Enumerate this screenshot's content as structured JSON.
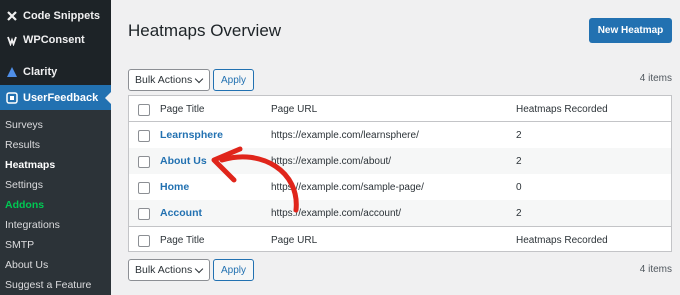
{
  "sidebar": {
    "top_items": [
      {
        "label": "Code Snippets",
        "icon": "code-snippets-icon"
      },
      {
        "label": "WPConsent",
        "icon": "wpconsent-icon"
      },
      {
        "label": "Clarity",
        "icon": "clarity-icon"
      }
    ],
    "active": {
      "label": "UserFeedback",
      "icon": "userfeedback-icon"
    },
    "submenu": [
      {
        "label": "Surveys"
      },
      {
        "label": "Results"
      },
      {
        "label": "Heatmaps",
        "current": true
      },
      {
        "label": "Settings"
      },
      {
        "label": "Addons",
        "accent": "#00c853"
      },
      {
        "label": "Integrations"
      },
      {
        "label": "SMTP"
      },
      {
        "label": "About Us"
      },
      {
        "label": "Suggest a Feature"
      }
    ]
  },
  "header": {
    "title": "Heatmaps Overview",
    "new_button": "New Heatmap"
  },
  "bulk_top": {
    "select": "Bulk Actions",
    "apply": "Apply",
    "count": "4 items"
  },
  "bulk_bottom": {
    "select": "Bulk Actions",
    "apply": "Apply",
    "count": "4 items"
  },
  "table": {
    "columns": [
      "Page Title",
      "Page URL",
      "Heatmaps Recorded"
    ],
    "rows": [
      {
        "title": "Learnsphere",
        "url": "https://example.com/learnsphere/",
        "recorded": "2"
      },
      {
        "title": "About Us",
        "url": "https://example.com/about/",
        "recorded": "2"
      },
      {
        "title": "Home",
        "url": "https://example.com/sample-page/",
        "recorded": "0"
      },
      {
        "title": "Account",
        "url": "https://example.com/account/",
        "recorded": "2"
      }
    ]
  },
  "colors": {
    "accent": "#2271b1",
    "sidebar_bg": "#1d2327",
    "annotation_arrow": "#e0251b"
  }
}
